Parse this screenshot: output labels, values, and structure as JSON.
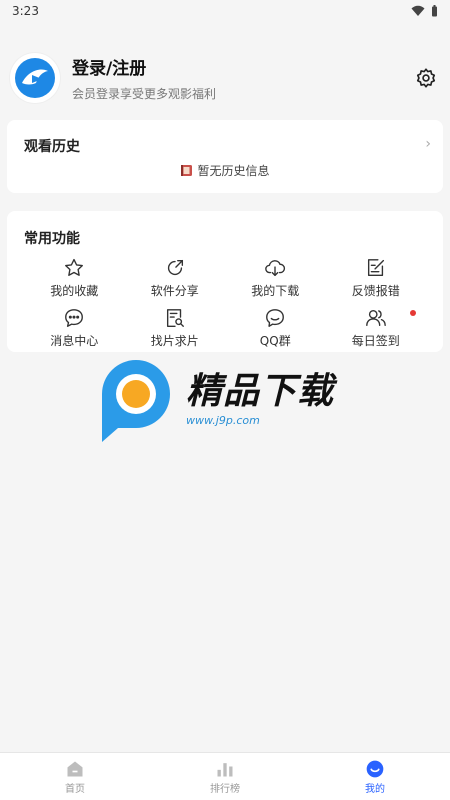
{
  "status_bar": {
    "time": "3:23"
  },
  "profile": {
    "title": "登录/注册",
    "subtitle": "会员登录享受更多观影福利"
  },
  "history": {
    "title": "观看历史",
    "empty_text": "暂无历史信息",
    "chevron": "›"
  },
  "functions": {
    "title": "常用功能",
    "items": [
      {
        "label": "我的收藏",
        "icon": "star-icon"
      },
      {
        "label": "软件分享",
        "icon": "share-icon"
      },
      {
        "label": "我的下载",
        "icon": "cloud-download-icon"
      },
      {
        "label": "反馈报错",
        "icon": "feedback-icon"
      },
      {
        "label": "消息中心",
        "icon": "message-icon"
      },
      {
        "label": "找片求片",
        "icon": "search-list-icon"
      },
      {
        "label": "QQ群",
        "icon": "chat-group-icon"
      },
      {
        "label": "每日签到",
        "icon": "users-icon"
      }
    ]
  },
  "watermark": {
    "title": "精品下载",
    "url": "www.j9p.com"
  },
  "tabbar": {
    "items": [
      {
        "label": "首页",
        "icon": "home-icon"
      },
      {
        "label": "排行榜",
        "icon": "chart-icon"
      },
      {
        "label": "我的",
        "icon": "profile-icon",
        "active": true
      }
    ]
  },
  "colors": {
    "accent": "#2a62ff",
    "badge": "#e53935",
    "background": "#f5f5f5"
  }
}
